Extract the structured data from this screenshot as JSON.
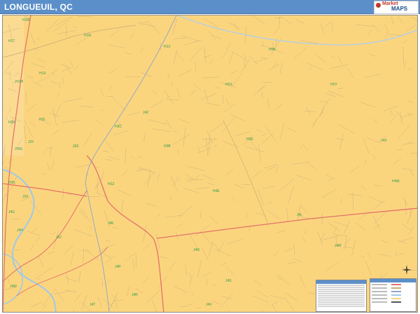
{
  "title": "LONGUEUIL, QC",
  "brand": {
    "line1": "Market",
    "line2": "MAPS"
  },
  "colors": {
    "land": "#fbd57e",
    "street": "#c7ad78",
    "highway": "#e3726a",
    "river": "#9ec9e9",
    "grid_label": "#2f9e4a",
    "header": "#5b8fc9"
  },
  "grid_labels": [
    "H1M",
    "H1N",
    "H1T",
    "H1V",
    "H1X",
    "H1W",
    "H2K",
    "H2L",
    "H2X",
    "H2Y",
    "H3C",
    "H3B",
    "H3E",
    "H3G",
    "H3K",
    "H3Z",
    "H4E",
    "H4M",
    "J3V",
    "J4G",
    "J4H",
    "J4J",
    "J4K",
    "J4L",
    "J4M",
    "J4N",
    "J4P",
    "J4R",
    "J4S",
    "J4T",
    "J4V",
    "J4W",
    "J3Y",
    "J3X",
    "J4Z",
    "J4X",
    "H5A"
  ],
  "icons": {
    "compass": "compass-rose-icon",
    "logo": "market-maps-logo"
  }
}
